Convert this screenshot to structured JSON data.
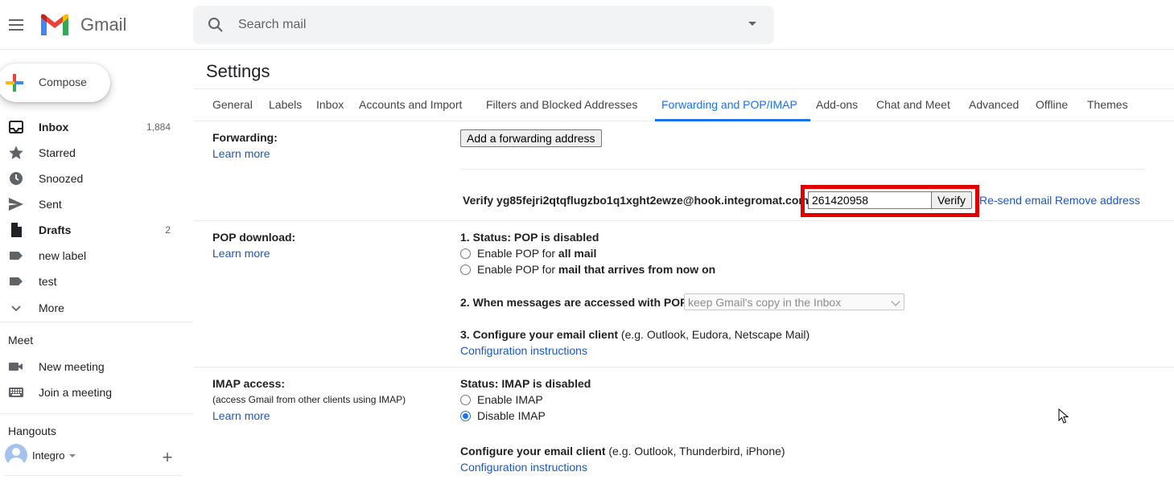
{
  "header": {
    "brand": "Gmail",
    "search_placeholder": "Search mail"
  },
  "sidebar": {
    "compose_label": "Compose",
    "items": [
      {
        "label": "Inbox",
        "count": "1,884",
        "icon": "inbox-icon",
        "bold": true
      },
      {
        "label": "Starred",
        "count": "",
        "icon": "star-icon",
        "bold": false
      },
      {
        "label": "Snoozed",
        "count": "",
        "icon": "clock-icon",
        "bold": false
      },
      {
        "label": "Sent",
        "count": "",
        "icon": "send-icon",
        "bold": false
      },
      {
        "label": "Drafts",
        "count": "2",
        "icon": "draft-icon",
        "bold": true
      },
      {
        "label": "new label",
        "count": "",
        "icon": "label-icon",
        "bold": false
      },
      {
        "label": "test",
        "count": "",
        "icon": "label-icon",
        "bold": false
      },
      {
        "label": "More",
        "count": "",
        "icon": "chevron-down-icon",
        "bold": false
      }
    ],
    "meet": {
      "title": "Meet",
      "new_meeting": "New meeting",
      "join_meeting": "Join a meeting"
    },
    "hangouts": {
      "title": "Hangouts",
      "user": "Integro"
    }
  },
  "settings": {
    "title": "Settings",
    "tabs": [
      "General",
      "Labels",
      "Inbox",
      "Accounts and Import",
      "Filters and Blocked Addresses",
      "Forwarding and POP/IMAP",
      "Add-ons",
      "Chat and Meet",
      "Advanced",
      "Offline",
      "Themes"
    ],
    "active_tab": "Forwarding and POP/IMAP",
    "forwarding": {
      "label": "Forwarding:",
      "learn_more": "Learn more",
      "add_button": "Add a forwarding address",
      "verify_text": "Verify yg85fejri2qtqflugzbo1q1xght2ewze@hook.integromat.com",
      "code_value": "261420958",
      "verify_button": "Verify",
      "resend": "Re-send email",
      "remove": "Remove address"
    },
    "pop": {
      "label": "POP download:",
      "learn_more": "Learn more",
      "status": "1. Status: POP is disabled",
      "option1_prefix": "Enable POP for ",
      "option1_bold": "all mail",
      "option2_prefix": "Enable POP for ",
      "option2_bold": "mail that arrives from now on",
      "access_label": "2. When messages are accessed with POP",
      "access_select": "keep Gmail's copy in the Inbox",
      "configure_bold": "3. Configure your email client",
      "configure_rest": " (e.g. Outlook, Eudora, Netscape Mail)",
      "config_link": "Configuration instructions"
    },
    "imap": {
      "label": "IMAP access:",
      "sub": "(access Gmail from other clients using IMAP)",
      "learn_more": "Learn more",
      "status": "Status: IMAP is disabled",
      "enable": "Enable IMAP",
      "disable": "Disable IMAP",
      "selected": "Disable IMAP",
      "configure_bold": "Configure your email client",
      "configure_rest": " (e.g. Outlook, Thunderbird, iPhone)",
      "config_link": "Configuration instructions"
    }
  },
  "colors": {
    "accent": "#1a73e8",
    "highlight": "#e30000",
    "link": "#1a57c4"
  }
}
